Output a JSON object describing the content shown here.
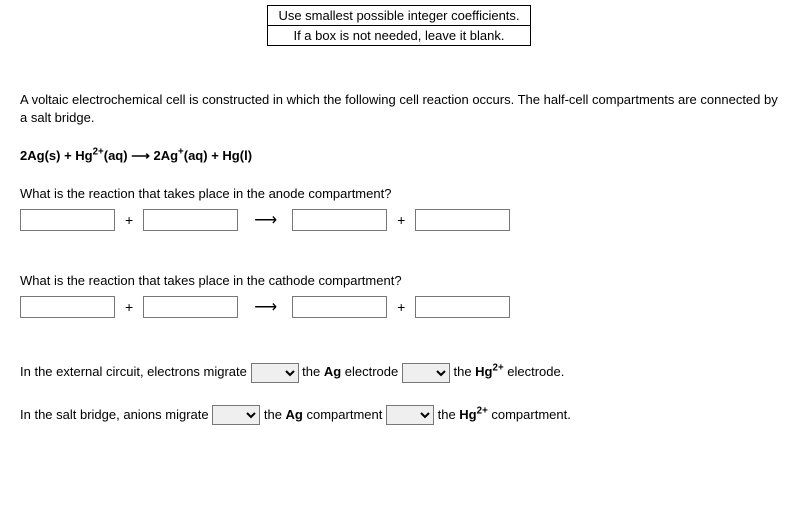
{
  "hints": {
    "line1": "Use smallest possible integer coefficients.",
    "line2": "If a box is not needed, leave it blank."
  },
  "intro": "A voltaic electrochemical cell is constructed in which the following cell reaction occurs. The half-cell compartments are connected by a salt bridge.",
  "equation": {
    "r1_coef": "2",
    "r1_species": "Ag(s)",
    "plus1": " + ",
    "r2_species_pre": "Hg",
    "r2_charge": "2+",
    "r2_species_post": "(aq)",
    "arrow": " ⟶ ",
    "p1_coef": "2",
    "p1_species_pre": "Ag",
    "p1_charge": "+",
    "p1_species_post": "(aq)",
    "plus2": " + ",
    "p2_species": "Hg(l)"
  },
  "q1": "What is the reaction that takes place in the anode compartment?",
  "q2": "What is the reaction that takes place in the cathode compartment?",
  "anode": {
    "r1": "",
    "r2": "",
    "p1": "",
    "p2": ""
  },
  "cathode": {
    "r1": "",
    "r2": "",
    "p1": "",
    "p2": ""
  },
  "symbols": {
    "plus": "+",
    "arrow": "⟶"
  },
  "para1": {
    "seg1": "In the external circuit, electrons migrate ",
    "seg2": " the ",
    "bold1": "Ag",
    "seg3": " electrode ",
    "seg4": " the ",
    "bold2_pre": "Hg",
    "bold2_sup": "2+",
    "seg5": " electrode."
  },
  "para2": {
    "seg1": "In the salt bridge, anions migrate ",
    "seg2": " the ",
    "bold1": "Ag",
    "seg3": " compartment ",
    "seg4": " the ",
    "bold2_pre": "Hg",
    "bold2_sup": "2+",
    "seg5": " compartment."
  },
  "dropdowns": {
    "external1": "",
    "external2": "",
    "salt1": "",
    "salt2": ""
  }
}
